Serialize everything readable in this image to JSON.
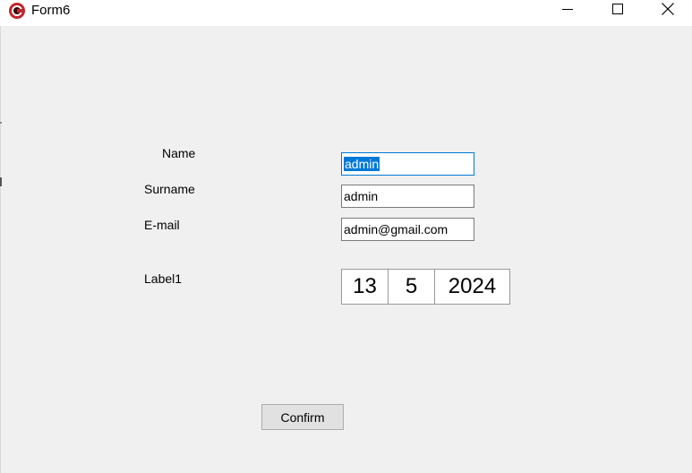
{
  "window": {
    "title": "Form6",
    "icon": "app-logo-icon",
    "controls": [
      "minimize-icon",
      "maximize-icon",
      "close-icon"
    ]
  },
  "form": {
    "name_label": "Name",
    "surname_label": "Surname",
    "email_label": "E-mail",
    "date_label": "Label1",
    "name_value": "admin",
    "surname_value": "admin",
    "email_value": "admin@gmail.com",
    "date": {
      "day": "13",
      "month": "5",
      "year": "2024"
    },
    "confirm_label": "Confirm"
  },
  "colors": {
    "selection": "#0078d7",
    "window_bg": "#f0f0f0",
    "icon_red": "#c0262d"
  }
}
